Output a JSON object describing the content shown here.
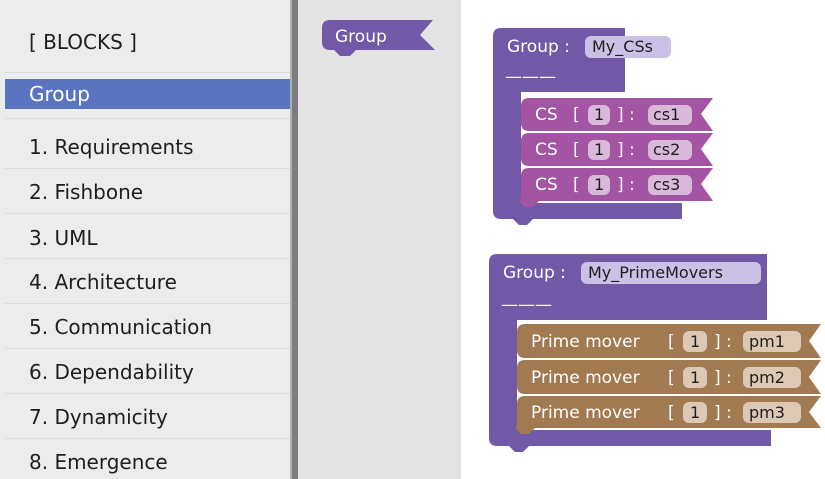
{
  "sidebar": {
    "items": [
      {
        "label": "[ BLOCKS ]",
        "selected": false
      },
      {
        "label": "Group",
        "selected": true
      },
      {
        "label": "1. Requirements",
        "selected": false
      },
      {
        "label": "2. Fishbone",
        "selected": false
      },
      {
        "label": "3. UML",
        "selected": false
      },
      {
        "label": "4. Architecture",
        "selected": false
      },
      {
        "label": "5. Communication",
        "selected": false
      },
      {
        "label": "6. Dependability",
        "selected": false
      },
      {
        "label": "7. Dynamicity",
        "selected": false
      },
      {
        "label": "8. Emergence",
        "selected": false
      }
    ]
  },
  "flyout": {
    "group_block_label": "Group"
  },
  "workspace": {
    "group1": {
      "prefix": "Group :",
      "name": "My_CSs",
      "divider": "———",
      "children": [
        {
          "type": "CS",
          "open": "[",
          "count": "1",
          "close": "] :",
          "name": "cs1"
        },
        {
          "type": "CS",
          "open": "[",
          "count": "1",
          "close": "] :",
          "name": "cs2"
        },
        {
          "type": "CS",
          "open": "[",
          "count": "1",
          "close": "] :",
          "name": "cs3"
        }
      ]
    },
    "group2": {
      "prefix": "Group :",
      "name": "My_PrimeMovers",
      "divider": "———",
      "children": [
        {
          "type": "Prime mover",
          "open": "[",
          "count": "1",
          "close": "] :",
          "name": "pm1"
        },
        {
          "type": "Prime mover",
          "open": "[",
          "count": "1",
          "close": "] :",
          "name": "pm2"
        },
        {
          "type": "Prime mover",
          "open": "[",
          "count": "1",
          "close": "] :",
          "name": "pm3"
        }
      ]
    }
  },
  "colors": {
    "group_block": "#7159a8",
    "cs_block": "#a354a2",
    "prime_mover_block": "#a17a52",
    "selected_item": "#5a74c0"
  }
}
